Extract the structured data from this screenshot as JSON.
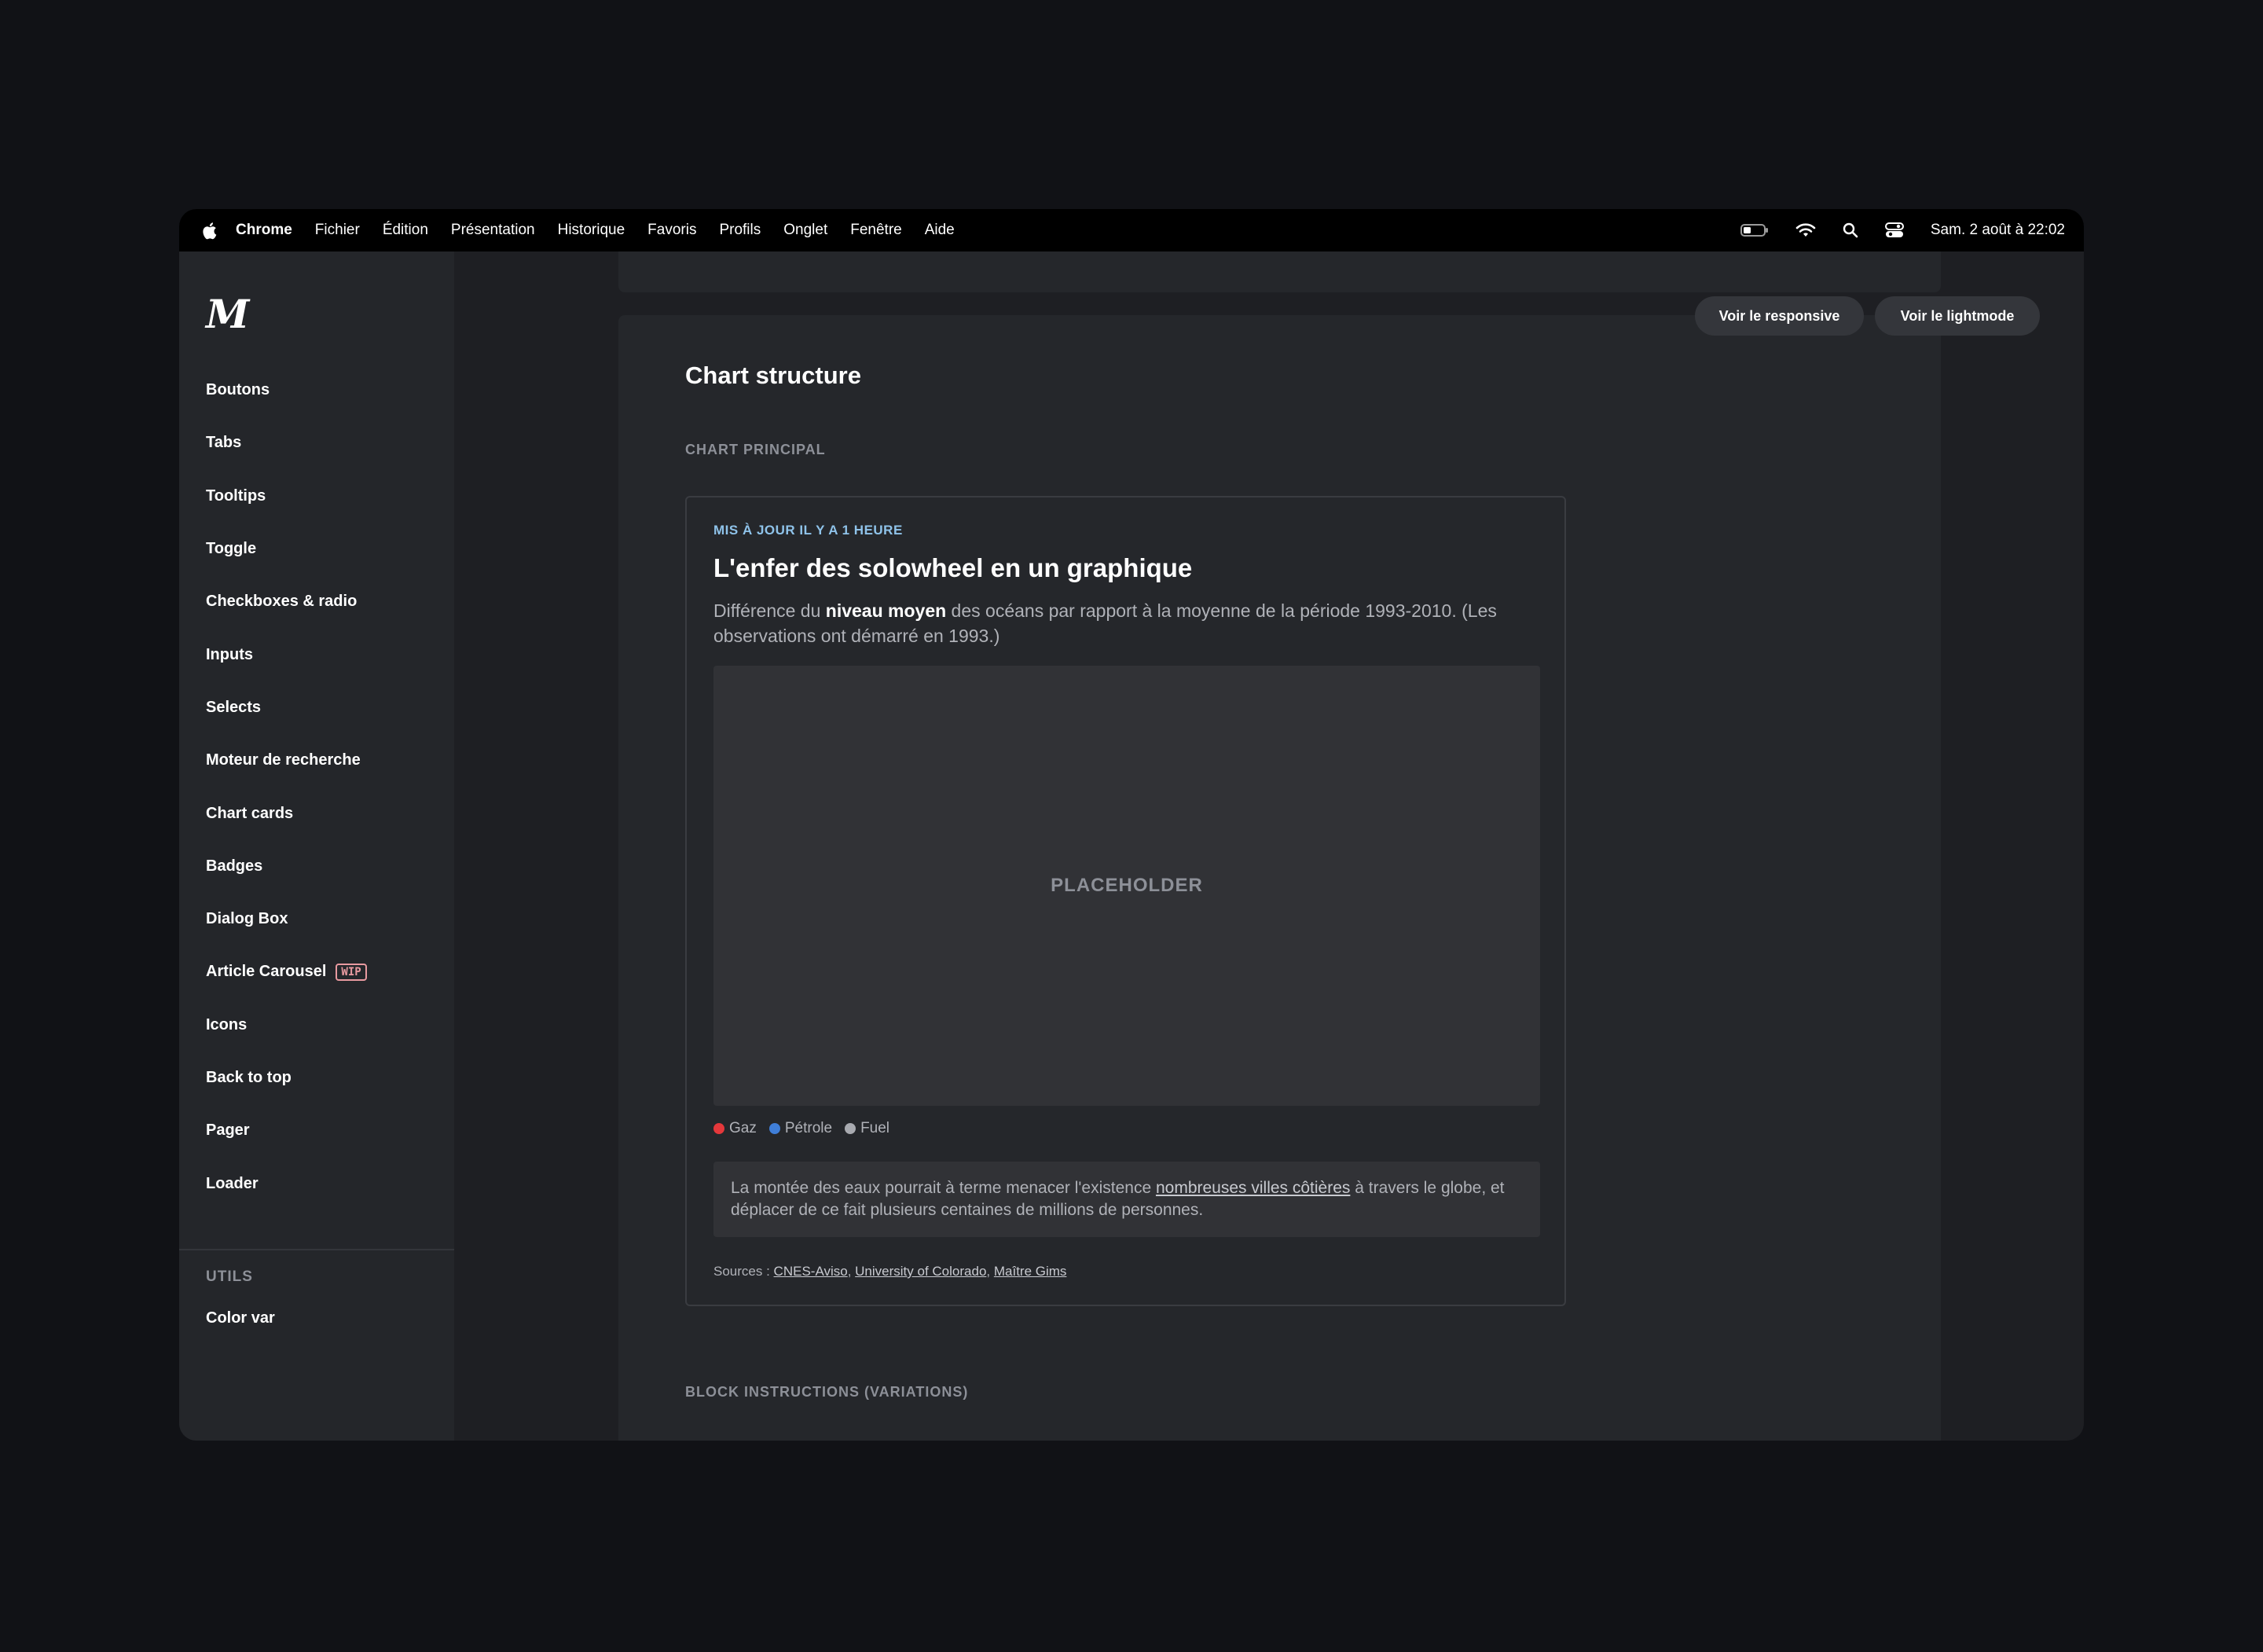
{
  "menubar": {
    "app": "Chrome",
    "items": [
      "Fichier",
      "Édition",
      "Présentation",
      "Historique",
      "Favoris",
      "Profils",
      "Onglet",
      "Fenêtre",
      "Aide"
    ],
    "clock": "Sam. 2 août à  22:02"
  },
  "sidebar": {
    "logo": "M",
    "items": [
      "Boutons",
      "Tabs",
      "Tooltips",
      "Toggle",
      "Checkboxes & radio",
      "Inputs",
      "Selects",
      "Moteur de recherche",
      "Chart cards",
      "Badges",
      "Dialog Box",
      "Article Carousel",
      "Icons",
      "Back to top",
      "Pager",
      "Loader"
    ],
    "wip_badge": "WIP",
    "utils_heading": "UTILS",
    "utils_items": [
      "Color var"
    ]
  },
  "toolbar": {
    "responsive_label": "Voir le responsive",
    "lightmode_label": "Voir le lightmode"
  },
  "main": {
    "section_title": "Chart structure",
    "section_label": "CHART PRINCIPAL",
    "block_label": "BLOCK INSTRUCTIONS (VARIATIONS)"
  },
  "card": {
    "updated": "MIS À JOUR IL Y A 1 HEURE",
    "title": "L'enfer des solowheel en un graphique",
    "desc_before": "Différence du ",
    "desc_bold": "niveau moyen",
    "desc_after": " des océans par rapport à la moyenne de la période 1993-2010. (Les observations ont démarré en 1993.)",
    "placeholder": "PLACEHOLDER",
    "legend": [
      {
        "label": "Gaz",
        "color": "#e5383b"
      },
      {
        "label": "Pétrole",
        "color": "#3f7ed8"
      },
      {
        "label": "Fuel",
        "color": "#a8aab0"
      }
    ],
    "note_before": "La montée des eaux pourrait à terme menacer l'existence ",
    "note_link": "nombreuses villes côtières",
    "note_after": " à travers le globe, et déplacer de ce fait plusieurs centaines de millions de personnes.",
    "sources_label": "Sources : ",
    "sources": [
      "CNES-Aviso",
      "University of Colorado",
      "Maître Gims"
    ]
  }
}
